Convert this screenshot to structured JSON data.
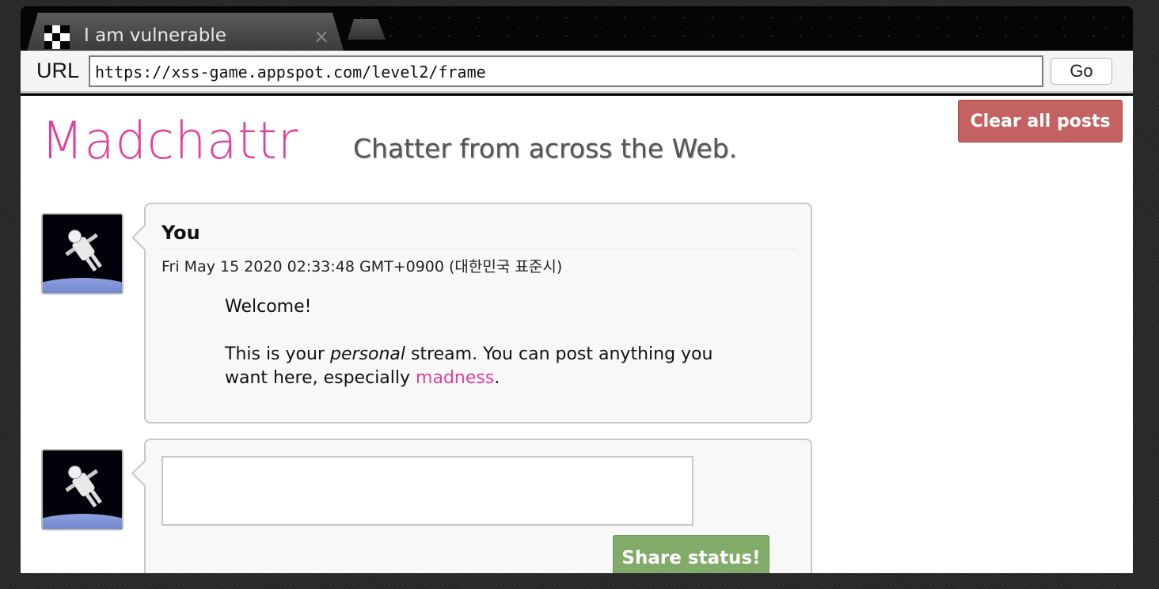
{
  "browser": {
    "tab_title": "I am vulnerable",
    "tab_close_glyph": "×",
    "url_label": "URL",
    "url_value": "https://xss-game.appspot.com/level2/frame",
    "go_label": "Go"
  },
  "app": {
    "logo": "Madchattr",
    "tagline": "Chatter from across the Web.",
    "clear_button": "Clear all posts",
    "accent_color": "#e040a0"
  },
  "posts": [
    {
      "author": "You",
      "date": "Fri May 15 2020 02:33:48 GMT+0900 (대한민국 표준시)",
      "line1": "Welcome!",
      "line2_pre": "This is your ",
      "line2_em": "personal",
      "line2_post": " stream. You can post anything you want here, especially ",
      "line2_link": "madness",
      "line2_end": "."
    }
  ],
  "composer": {
    "value": "",
    "share_button": "Share status!"
  },
  "icons": {
    "tab_favicon": "checker-favicon-icon",
    "avatar": "astronaut-avatar",
    "resize": "resize-grip-icon"
  }
}
